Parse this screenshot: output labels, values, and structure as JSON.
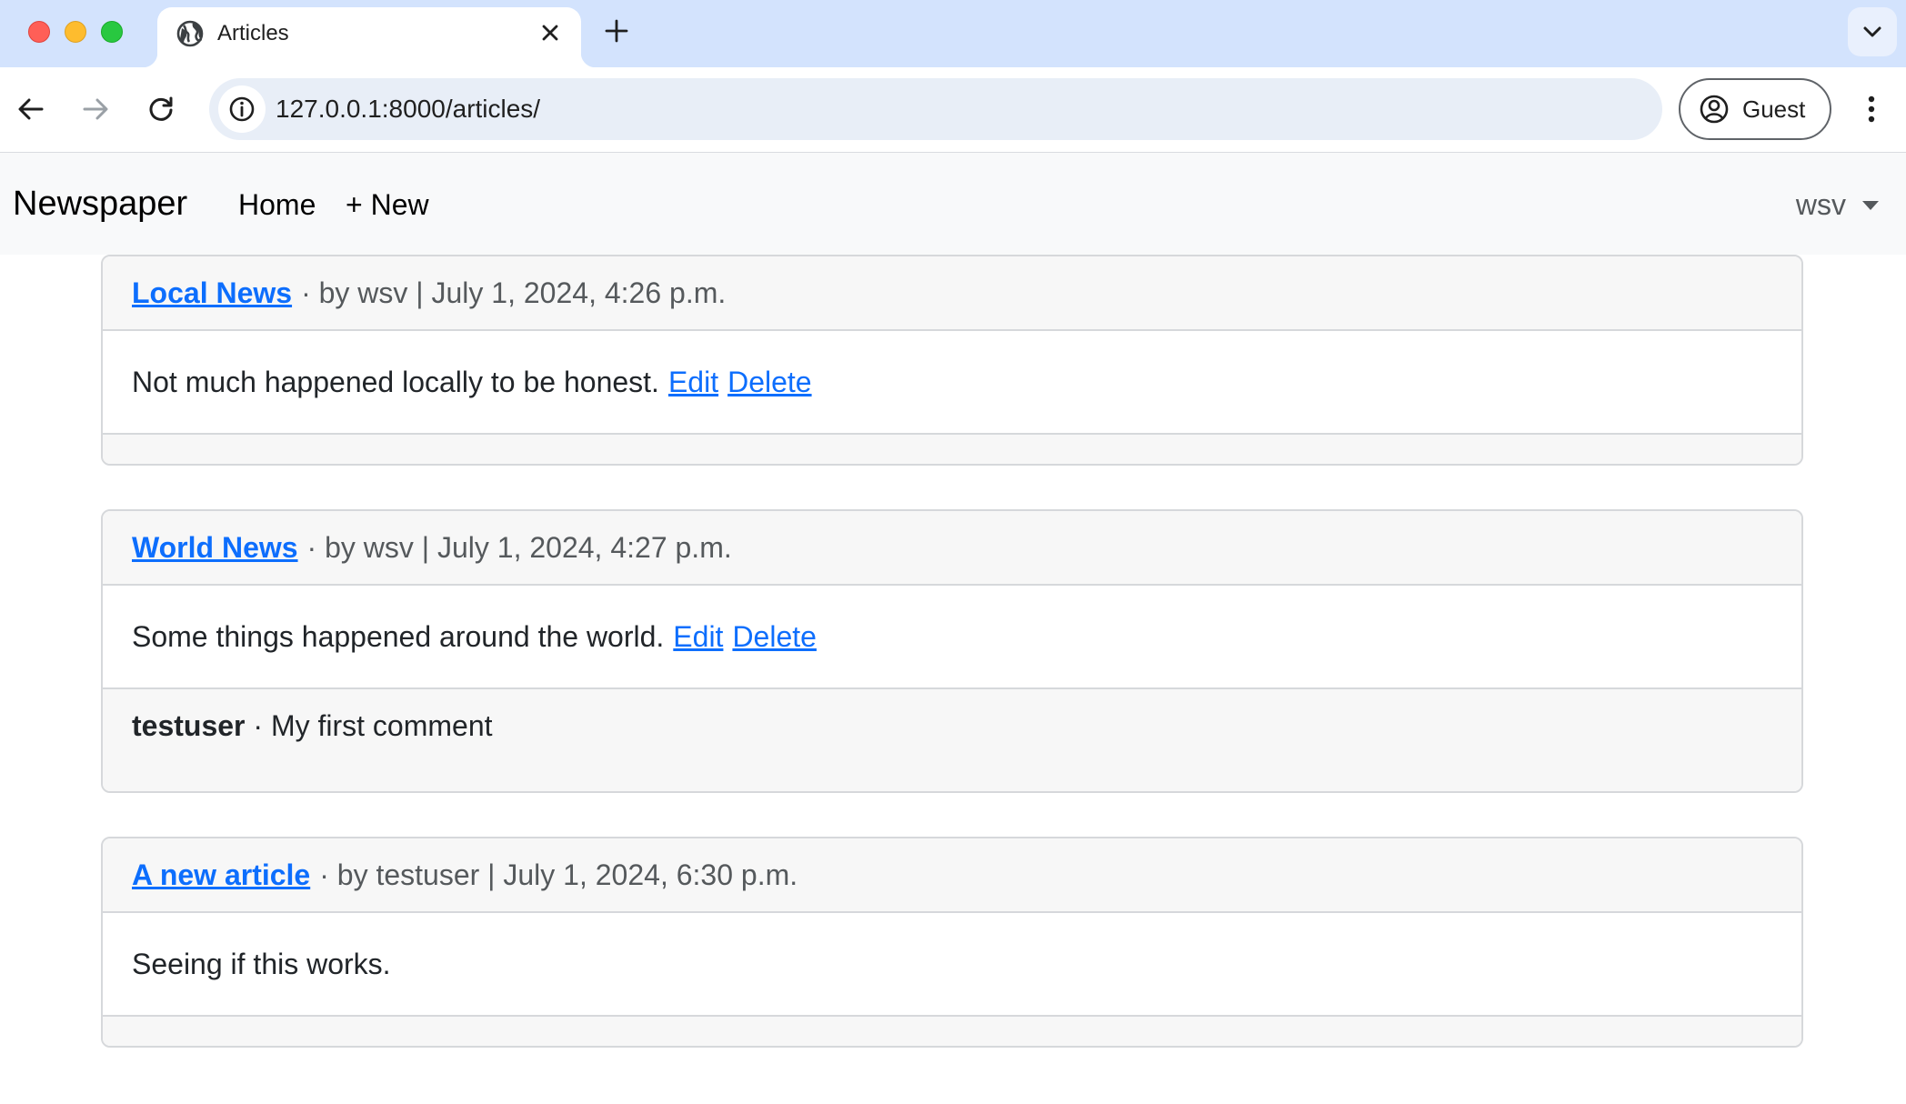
{
  "browser": {
    "tab_title": "Articles",
    "url": "127.0.0.1:8000/articles/",
    "profile_label": "Guest"
  },
  "navbar": {
    "brand": "Newspaper",
    "links": [
      {
        "label": "Home"
      },
      {
        "label": "+ New"
      }
    ],
    "user": "wsv"
  },
  "articles": [
    {
      "title": "Local News",
      "meta": "· by wsv | July 1, 2024, 4:26 p.m.",
      "body": "Not much happened locally to be honest.",
      "edit_label": "Edit",
      "delete_label": "Delete",
      "comments": []
    },
    {
      "title": "World News",
      "meta": "· by wsv | July 1, 2024, 4:27 p.m.",
      "body": "Some things happened around the world.",
      "edit_label": "Edit",
      "delete_label": "Delete",
      "comments": [
        {
          "author": "testuser",
          "text": "· My first comment"
        }
      ]
    },
    {
      "title": "A new article",
      "meta": "· by testuser | July 1, 2024, 6:30 p.m.",
      "body": "Seeing if this works.",
      "comments": []
    }
  ]
}
